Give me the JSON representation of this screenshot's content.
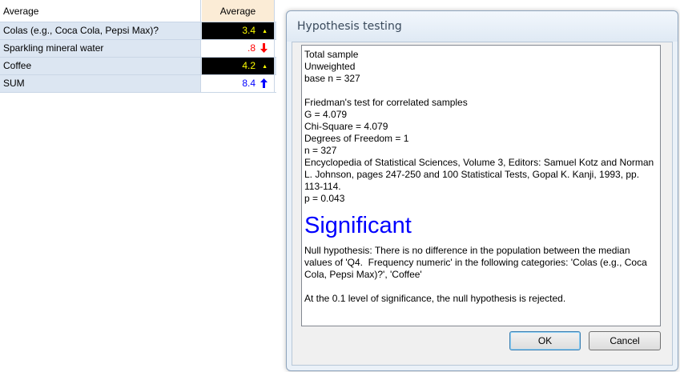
{
  "table": {
    "header": {
      "label": "Average",
      "col": "Average"
    },
    "rows": [
      {
        "label": "Colas (e.g., Coca Cola, Pepsi Max)?",
        "value": "3.4",
        "mark": "▲",
        "value_color": "#ffff00",
        "mark_color": "#ffff00"
      },
      {
        "label": "Sparkling mineral water",
        "value": ".8",
        "mark": "🡓",
        "value_color": "#ff0000",
        "mark_color": "#ff0000"
      },
      {
        "label": "Coffee",
        "value": "4.2",
        "mark": "▲",
        "value_color": "#ffff00",
        "mark_color": "#ffff00"
      },
      {
        "label": "SUM",
        "value": "8.4",
        "mark": "🡑",
        "value_color": "#0000ff",
        "mark_color": "#0000ff"
      }
    ]
  },
  "dialog": {
    "title": "Hypothesis testing",
    "lines": [
      "Total sample",
      "Unweighted",
      "base n = 327",
      "",
      "Friedman's test for correlated samples",
      "G = 4.079",
      "Chi-Square = 4.079",
      "Degrees of Freedom = 1",
      "n = 327",
      "Encyclopedia of Statistical Sciences, Volume 3, Editors: Samuel Kotz and Norman L. Johnson, pages 247-250 and 100 Statistical Tests, Gopal K. Kanji, 1993, pp. 113-114.",
      "p = 0.043"
    ],
    "significant_label": "Significant",
    "null_hypothesis": "Null hypothesis: There is no difference in the population between the median values of 'Q4.  Frequency numeric' in the following categories: 'Colas (e.g., Coca Cola, Pepsi Max)?', 'Coffee'",
    "conclusion": "At the 0.1 level of significance, the null hypothesis is rejected.",
    "ok_label": "OK",
    "cancel_label": "Cancel"
  },
  "colors": {
    "row_bg": "#dce6f2",
    "header_value_bg": "#fbecd6",
    "significant": "#0000ff"
  }
}
